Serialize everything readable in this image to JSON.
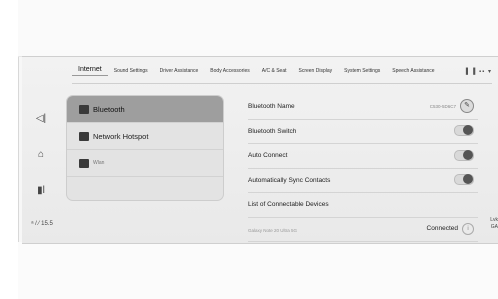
{
  "tabs": [
    {
      "label": "Internet"
    },
    {
      "label": "Sound Settings"
    },
    {
      "label": "Driver Assistance"
    },
    {
      "label": "Body Accessories"
    },
    {
      "label": "A/C & Seat"
    },
    {
      "label": "Screen Display"
    },
    {
      "label": "System Settings"
    },
    {
      "label": "Speech Assistance"
    }
  ],
  "tabs_more": "▌▐ ▪▪ ▾",
  "rail": {
    "item1_icon": "◁|",
    "item2_icon": "⌂",
    "item3_icon": "▮l",
    "item4_text": "ᵃ / ⁄ 15.5"
  },
  "menu": {
    "items": [
      {
        "label": "Bluetooth",
        "icon": "bluetooth-icon"
      },
      {
        "label": "Network Hotspot",
        "icon": "hotspot-icon"
      },
      {
        "label": "Wlan",
        "icon": "wlan-icon"
      }
    ]
  },
  "settings": {
    "bt_name_label": "Bluetooth Name",
    "bt_name_value": "C530-5D6C7",
    "bt_switch_label": "Bluetooth Switch",
    "auto_connect_label": "Auto Connect",
    "auto_sync_label": "Automatically Sync Contacts",
    "devices_label": "List of Connectable Devices",
    "device_name": "Galaxy Note 20 Ultra 5G",
    "device_status": "Connected"
  },
  "right_edge_text": "Lvk GA"
}
